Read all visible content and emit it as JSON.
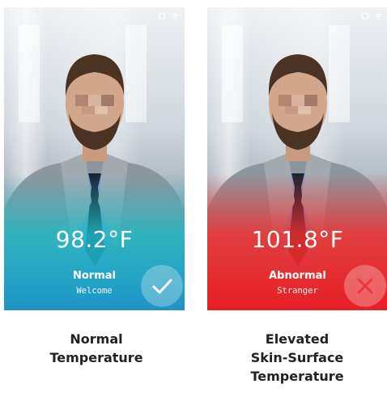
{
  "panels": [
    {
      "temperature": "98.2°F",
      "status": "Normal",
      "subtitle": "Welcome",
      "badge_icon": "check-icon",
      "accent_color": "#1fb8c4",
      "caption_line1": "Normal",
      "caption_line2": "Temperature",
      "caption_line3": ""
    },
    {
      "temperature": "101.8°F",
      "status": "Abnormal",
      "subtitle": "Stranger",
      "badge_icon": "close-icon",
      "accent_color": "#ee2e2e",
      "caption_line1": "Elevated",
      "caption_line2": "Skin-Surface",
      "caption_line3": "Temperature"
    }
  ],
  "status_bar_icons": [
    "shield-icon",
    "wifi-icon"
  ]
}
